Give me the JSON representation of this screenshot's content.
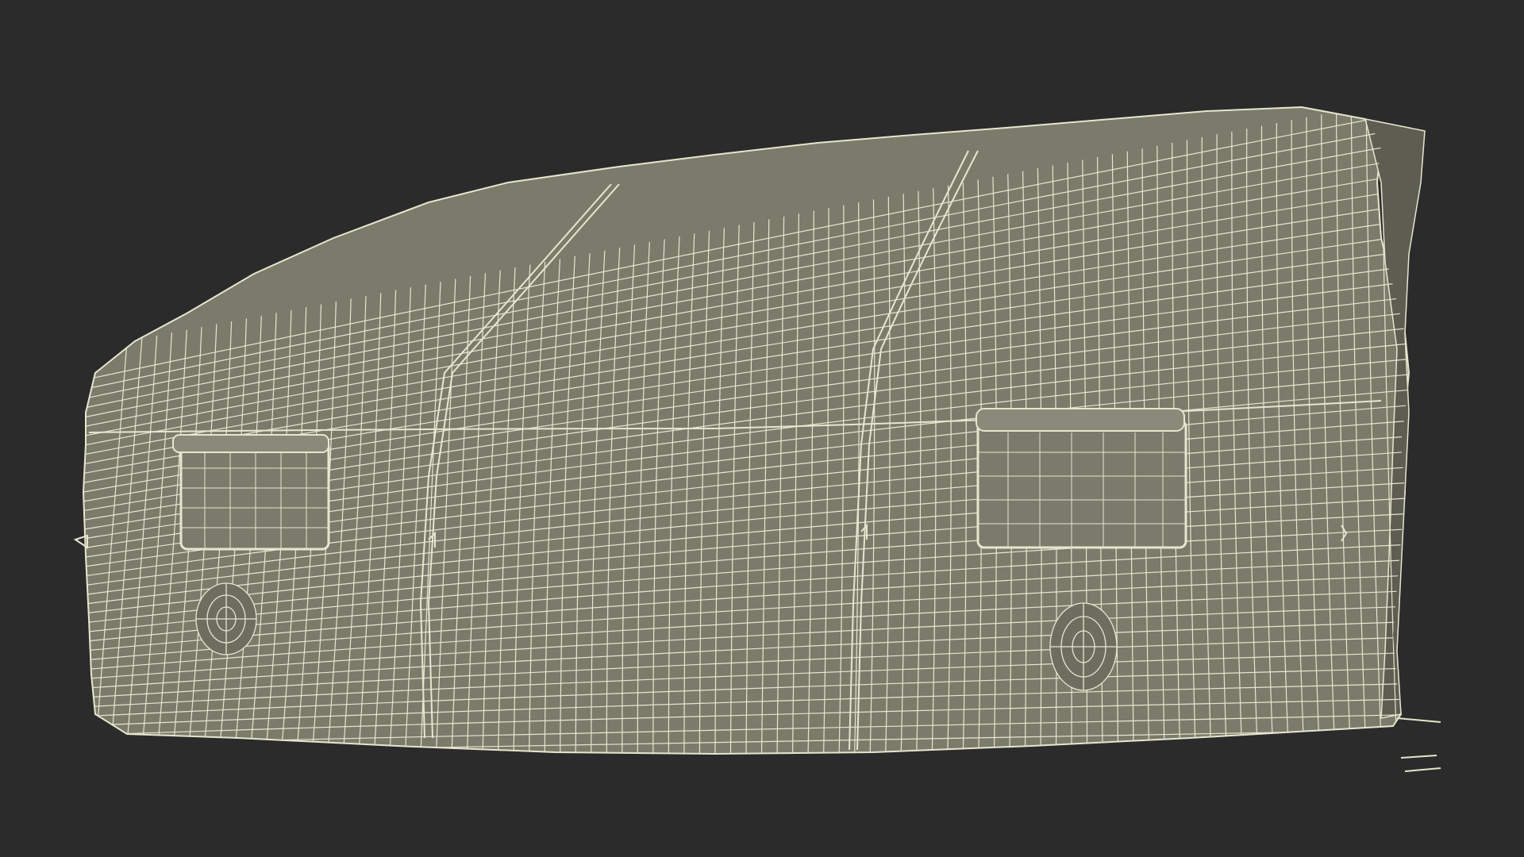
{
  "scene": {
    "background_color": "#2b2b2b",
    "subject": "tent-wireframe-model",
    "render_style": "wireframe",
    "surface_color": "#7b7b6c",
    "wire_color": "#e6e6cf",
    "shadow_color": "#5d5d52"
  }
}
